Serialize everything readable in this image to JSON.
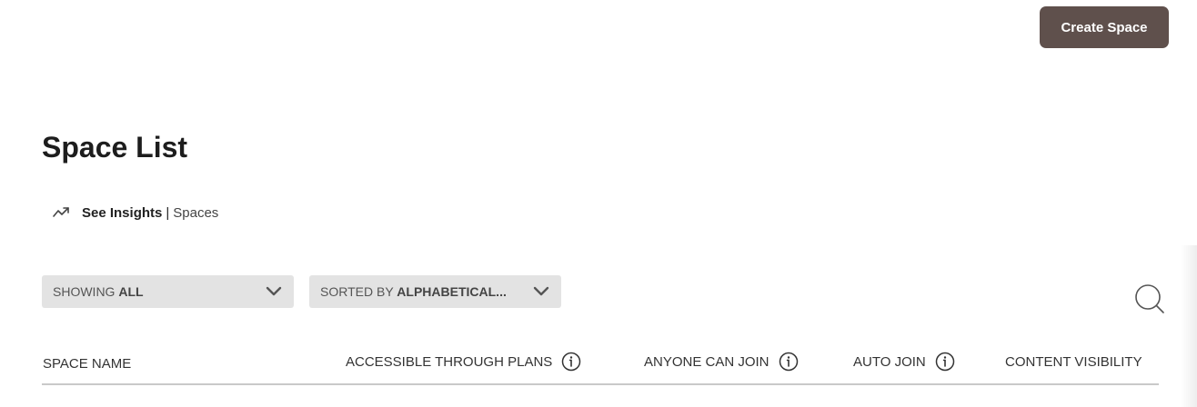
{
  "header": {
    "create_button_label": "Create Space"
  },
  "page": {
    "title": "Space List"
  },
  "insights": {
    "icon": "trending-up-icon",
    "see_label": "See Insights",
    "separator": "|",
    "spaces_label": "Spaces"
  },
  "filters": {
    "showing": {
      "prefix": "SHOWING",
      "value": "ALL"
    },
    "sorted": {
      "prefix": "SORTED BY",
      "value": "ALPHABETICAL..."
    }
  },
  "search": {
    "icon": "search-icon"
  },
  "table": {
    "columns": {
      "space_name": "SPACE NAME",
      "accessible_through_plans": "ACCESSIBLE THROUGH PLANS",
      "anyone_can_join": "ANYONE CAN JOIN",
      "auto_join": "AUTO JOIN",
      "content_visibility": "CONTENT VISIBILITY"
    }
  },
  "colors": {
    "primary_button": "#5f504c",
    "dropdown_bg": "#e3e3e3",
    "header_border": "#c9c9c9"
  }
}
